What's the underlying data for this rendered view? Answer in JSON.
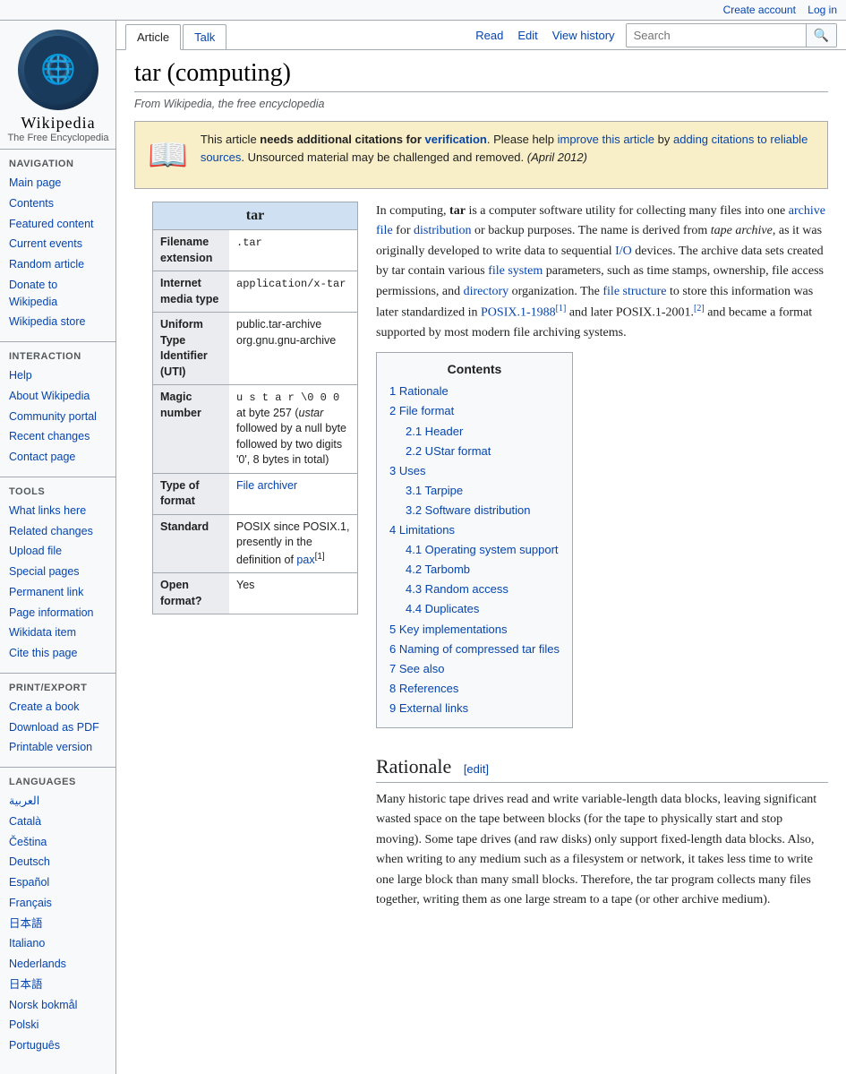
{
  "topbar": {
    "create_account": "Create account",
    "log_in": "Log in"
  },
  "logo": {
    "title": "Wikipedia",
    "subtitle": "The Free Encyclopedia"
  },
  "sidebar": {
    "navigation_title": "Navigation",
    "items_nav": [
      {
        "label": "Main page",
        "href": "#"
      },
      {
        "label": "Contents",
        "href": "#"
      },
      {
        "label": "Featured content",
        "href": "#"
      },
      {
        "label": "Current events",
        "href": "#"
      },
      {
        "label": "Random article",
        "href": "#"
      },
      {
        "label": "Donate to Wikipedia",
        "href": "#"
      },
      {
        "label": "Wikipedia store",
        "href": "#"
      }
    ],
    "interaction_title": "Interaction",
    "items_interaction": [
      {
        "label": "Help",
        "href": "#"
      },
      {
        "label": "About Wikipedia",
        "href": "#"
      },
      {
        "label": "Community portal",
        "href": "#"
      },
      {
        "label": "Recent changes",
        "href": "#"
      },
      {
        "label": "Contact page",
        "href": "#"
      }
    ],
    "tools_title": "Tools",
    "items_tools": [
      {
        "label": "What links here",
        "href": "#"
      },
      {
        "label": "Related changes",
        "href": "#"
      },
      {
        "label": "Upload file",
        "href": "#"
      },
      {
        "label": "Special pages",
        "href": "#"
      },
      {
        "label": "Permanent link",
        "href": "#"
      },
      {
        "label": "Page information",
        "href": "#"
      },
      {
        "label": "Wikidata item",
        "href": "#"
      },
      {
        "label": "Cite this page",
        "href": "#"
      }
    ],
    "print_title": "Print/export",
    "items_print": [
      {
        "label": "Create a book",
        "href": "#"
      },
      {
        "label": "Download as PDF",
        "href": "#"
      },
      {
        "label": "Printable version",
        "href": "#"
      }
    ],
    "languages_title": "Languages",
    "items_languages": [
      {
        "label": "العربية",
        "href": "#"
      },
      {
        "label": "Català",
        "href": "#"
      },
      {
        "label": "Čeština",
        "href": "#"
      },
      {
        "label": "Deutsch",
        "href": "#"
      },
      {
        "label": "Español",
        "href": "#"
      },
      {
        "label": "Français",
        "href": "#"
      },
      {
        "label": "日本語",
        "href": "#"
      },
      {
        "label": "Italiano",
        "href": "#"
      },
      {
        "label": "Nederlands",
        "href": "#"
      },
      {
        "label": "日本語",
        "href": "#"
      },
      {
        "label": "Norsk bokmål",
        "href": "#"
      },
      {
        "label": "Polski",
        "href": "#"
      },
      {
        "label": "Português",
        "href": "#"
      }
    ]
  },
  "tabs": {
    "article": "Article",
    "talk": "Talk",
    "read": "Read",
    "edit": "Edit",
    "view_history": "View history"
  },
  "search": {
    "placeholder": "Search",
    "button": "🔍"
  },
  "article": {
    "title": "tar (computing)",
    "subtitle": "From Wikipedia, the free encyclopedia",
    "citation_box": {
      "icon": "📖",
      "text_before": "This article ",
      "bold1": "needs additional citations for ",
      "link1": "verification",
      "text2": ". Please help ",
      "link2": "improve this article",
      "text3": " by ",
      "link3": "adding citations to reliable sources",
      "text4": ". Unsourced material may be challenged and removed.",
      "date": "(April 2012)"
    },
    "intro": "In computing, tar is a computer software utility for collecting many files into one archive file for distribution or backup purposes. The name is derived from tape archive, as it was originally developed to write data to sequential I/O devices. The archive data sets created by tar contain various file system parameters, such as time stamps, ownership, file access permissions, and directory organization. The file structure to store this information was later standardized in POSIX.1-1988[1] and later POSIX.1-2001.[2] and became a format supported by most modern file archiving systems.",
    "infobox": {
      "title": "tar",
      "rows": [
        {
          "label": "Filename extension",
          "value": ".tar"
        },
        {
          "label": "Internet media type",
          "value": "application/x-tar"
        },
        {
          "label": "Uniform Type Identifier (UTI)",
          "value": "public.tar-archive org.gnu.gnu-archive"
        },
        {
          "label": "Magic number",
          "value": "u s t a r \\0 0 0 at byte 257 (ustar followed by a null byte followed by two digits '0', 8 bytes in total)"
        },
        {
          "label": "Type of format",
          "value": "File archiver"
        },
        {
          "label": "Standard",
          "value": "POSIX since POSIX.1, presently in the definition of pax[1]"
        },
        {
          "label": "Open format?",
          "value": "Yes"
        }
      ]
    },
    "contents": {
      "title": "Contents",
      "items": [
        {
          "num": "1",
          "label": "Rationale",
          "sub": []
        },
        {
          "num": "2",
          "label": "File format",
          "sub": [
            {
              "num": "2.1",
              "label": "Header"
            },
            {
              "num": "2.2",
              "label": "UStar format"
            }
          ]
        },
        {
          "num": "3",
          "label": "Uses",
          "sub": [
            {
              "num": "3.1",
              "label": "Tarpipe"
            },
            {
              "num": "3.2",
              "label": "Software distribution"
            }
          ]
        },
        {
          "num": "4",
          "label": "Limitations",
          "sub": [
            {
              "num": "4.1",
              "label": "Operating system support"
            },
            {
              "num": "4.2",
              "label": "Tarbomb"
            },
            {
              "num": "4.3",
              "label": "Random access"
            },
            {
              "num": "4.4",
              "label": "Duplicates"
            }
          ]
        },
        {
          "num": "5",
          "label": "Key implementations",
          "sub": []
        },
        {
          "num": "6",
          "label": "Naming of compressed tar files",
          "sub": []
        },
        {
          "num": "7",
          "label": "See also",
          "sub": []
        },
        {
          "num": "8",
          "label": "References",
          "sub": []
        },
        {
          "num": "9",
          "label": "External links",
          "sub": []
        }
      ]
    },
    "rationale": {
      "heading": "Rationale",
      "edit_label": "[edit]",
      "text": "Many historic tape drives read and write variable-length data blocks, leaving significant wasted space on the tape between blocks (for the tape to physically start and stop moving). Some tape drives (and raw disks) only support fixed-length data blocks. Also, when writing to any medium such as a filesystem or network, it takes less time to write one large block than many small blocks. Therefore, the tar program collects many files together, writing them as one large stream to a tape (or other archive medium)."
    }
  }
}
